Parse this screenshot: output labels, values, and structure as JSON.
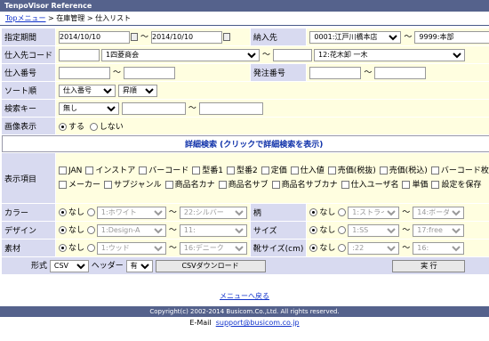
{
  "app_title": "TenpoVisor Reference",
  "breadcrumb": {
    "home": "Topメニュー",
    "sep1": " > ",
    "section": "在庫管理",
    "sep2": " > ",
    "current": "仕入リスト"
  },
  "form": {
    "period_label": "指定期間",
    "date_from": "2014/10/10",
    "date_to": "2014/10/10",
    "tilde": "～",
    "delivery_label": "納入先",
    "delivery_from": "0001:江戸川橋本店",
    "delivery_to": "9999:本部",
    "supplier_label": "仕入先コード",
    "supplier_from_name": "1四菱商会",
    "supplier_to_name": "12:花木卸 一木",
    "purchase_no_label": "仕入番号",
    "order_no_label": "発注番号",
    "sort_label": "ソート順",
    "sort_field": "仕入番号",
    "sort_order": "昇順",
    "search_key_label": "検索キー",
    "search_key": "無し",
    "image_label": "画像表示",
    "image_on": "する",
    "image_off": "しない",
    "detail_search": "詳細検索 (クリックで詳細検索を表示)",
    "display_items_label": "表示項目",
    "display_items": [
      "JAN",
      "インストア",
      "バーコード",
      "型番1",
      "型番2",
      "定価",
      "仕入値",
      "売価(税抜)",
      "売価(税込)",
      "バーコード枚数",
      "メーカー",
      "サブジャンル",
      "商品名カナ",
      "商品名サブ",
      "商品名サブカナ",
      "仕入ユーザ名",
      "単価",
      "設定を保存"
    ],
    "attrs": [
      {
        "label": "カラー",
        "none": "なし",
        "from": "1:ホワイト",
        "to": "22:シルバー",
        "label2": "柄",
        "from2": "1:ストライプ",
        "to2": "14:ボーダー"
      },
      {
        "label": "デザイン",
        "none": "なし",
        "from": "1:Design-A",
        "to": "11:",
        "label2": "サイズ",
        "from2": "1:SS",
        "to2": "17:free"
      },
      {
        "label": "素材",
        "none": "なし",
        "from": "1:ウッド",
        "to": "16:デニーク",
        "label2": "靴サイズ(cm)",
        "from2": ":22",
        "to2": "16:"
      }
    ],
    "format_label": "形式",
    "format": "CSV",
    "header_label": "ヘッダー",
    "header": "有",
    "csv_button": "CSVダウンロード",
    "run_button": "実 行"
  },
  "footer": {
    "menu_back": "メニューへ戻る",
    "copyright": "Copyright(c) 2002-2014 Busicom.Co.,Ltd. All rights reserved.",
    "email_label": "E-Mail",
    "email": "support@busicom.co.jp"
  }
}
